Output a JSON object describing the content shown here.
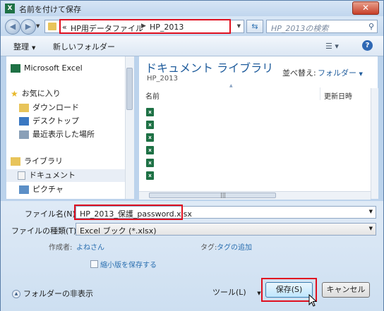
{
  "window": {
    "title": "名前を付けて保存",
    "close_label": "✕"
  },
  "address": {
    "crumbs": [
      "HP用データファイル",
      "HP_2013"
    ],
    "overflow_label": "«"
  },
  "search": {
    "placeholder": "HP_2013の検索"
  },
  "toolbar": {
    "organize_label": "整理",
    "new_folder_label": "新しいフォルダー"
  },
  "nav": {
    "items": [
      {
        "label": "Microsoft Excel",
        "icon": "excel-icon"
      },
      {
        "label": "お気に入り",
        "icon": "star-icon"
      },
      {
        "label": "ダウンロード",
        "icon": "download-folder-icon"
      },
      {
        "label": "デスクトップ",
        "icon": "desktop-icon"
      },
      {
        "label": "最近表示した場所",
        "icon": "recent-places-icon"
      },
      {
        "label": "ライブラリ",
        "icon": "library-icon"
      },
      {
        "label": "ドキュメント",
        "icon": "documents-icon"
      },
      {
        "label": "ピクチャ",
        "icon": "pictures-icon"
      }
    ]
  },
  "library": {
    "title": "ドキュメント ライブラリ",
    "subtitle": "HP_2013",
    "arrange_label": "並べ替え:",
    "arrange_value": "フォルダー"
  },
  "columns": {
    "name": "名前",
    "date": "更新日時"
  },
  "files": {
    "count": 6
  },
  "form": {
    "filename_label": "ファイル名(N):",
    "filename_value": "HP_2013_保護_password.xlsx",
    "filetype_label": "ファイルの種類(T):",
    "filetype_value": "Excel ブック (*.xlsx)",
    "author_label": "作成者:",
    "author_value": "よねさん",
    "tags_label": "タグ:",
    "tags_value": "タグの追加",
    "thumbnail_label": "縮小版を保存する",
    "hide_folders_label": "フォルダーの非表示",
    "tools_label": "ツール(L)",
    "save_label": "保存(S)",
    "cancel_label": "キャンセル"
  },
  "colors": {
    "highlight_red": "#e0101f",
    "link_blue": "#2a6fb0",
    "excel_green": "#1e7145"
  }
}
